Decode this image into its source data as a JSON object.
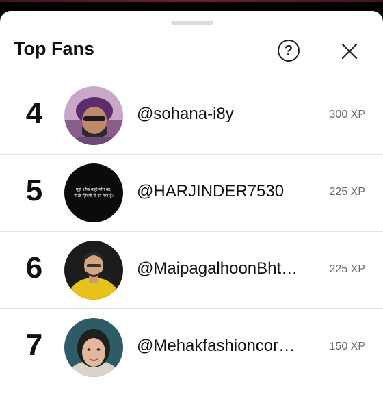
{
  "header": {
    "title": "Top Fans",
    "help_label": "?"
  },
  "fans": [
    {
      "rank": "4",
      "username": "@sohana-i8y",
      "xp": "300 XP"
    },
    {
      "rank": "5",
      "username": "@HARJINDER7530",
      "xp": "225 XP",
      "avatar_text": [
        "मुझे शौक कहां मौत का,",
        "मैं तो ज़िंदगी से डर गया हूँ।"
      ]
    },
    {
      "rank": "6",
      "username": "@MaipagalhoonBht…",
      "xp": "225 XP"
    },
    {
      "rank": "7",
      "username": "@Mehakfashioncor…",
      "xp": "150 XP"
    }
  ],
  "colors": {
    "background": "#ffffff",
    "text": "#111111",
    "muted": "#6b6b6b",
    "divider": "#e4e4e4"
  },
  "icons": {
    "help": "help-circle-icon",
    "close": "close-icon"
  }
}
